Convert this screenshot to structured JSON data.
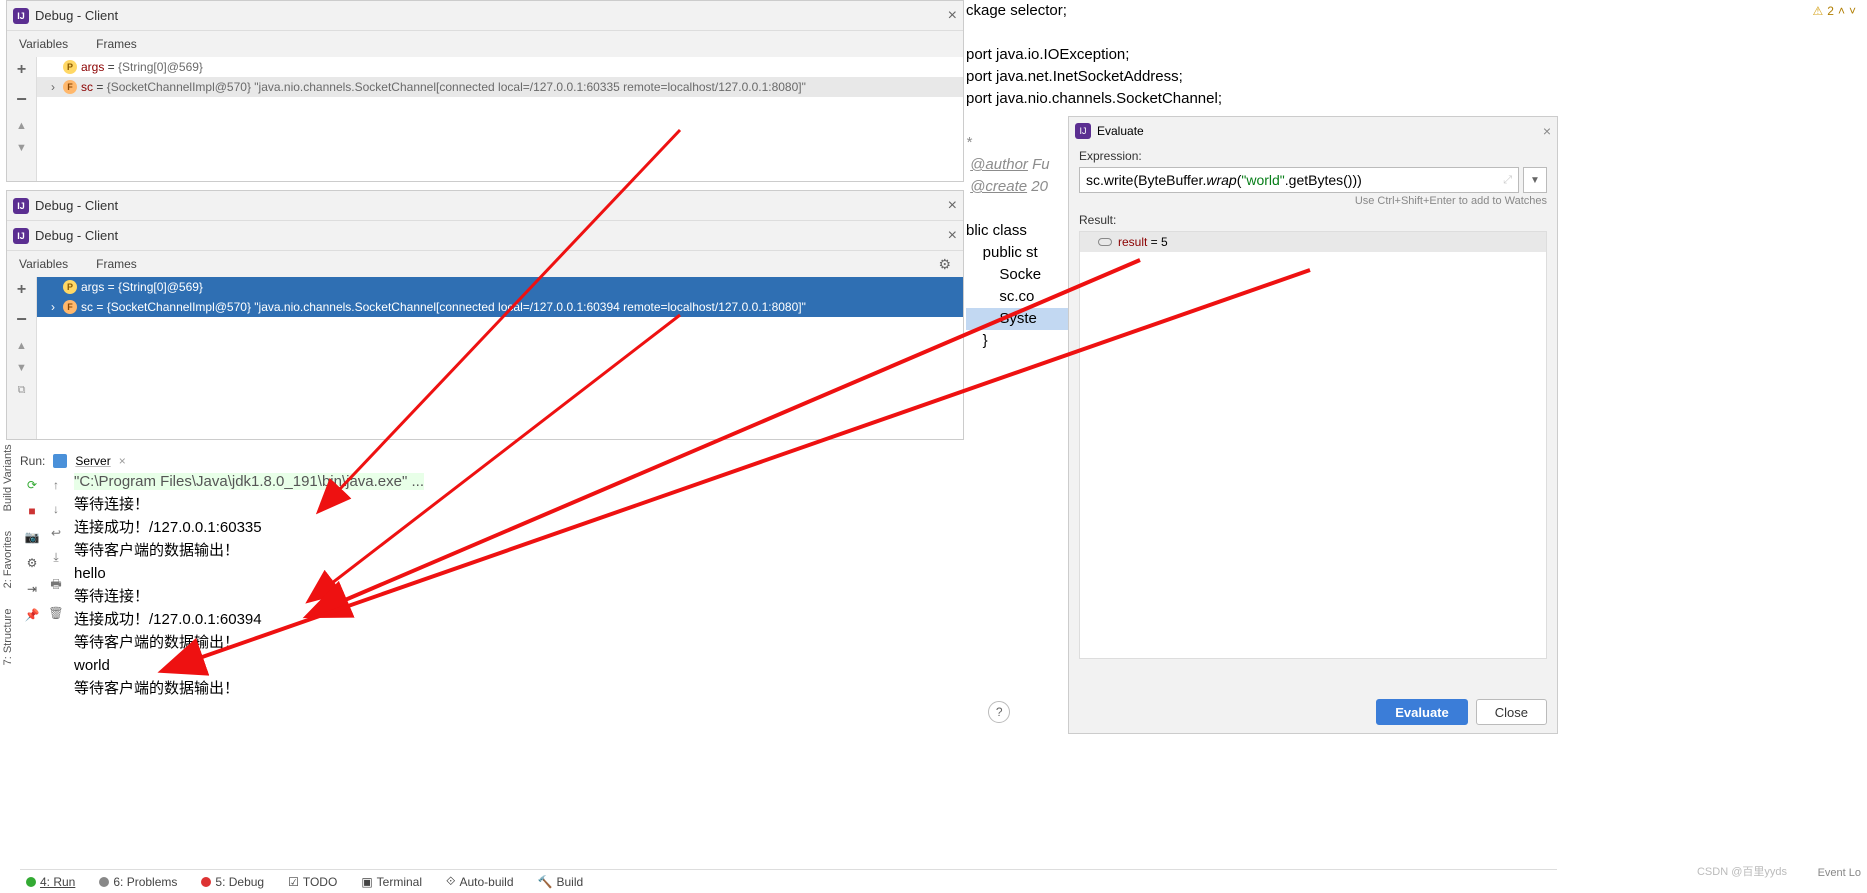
{
  "panel1": {
    "title": "Debug - Client",
    "tab_vars": "Variables",
    "tab_frames": "Frames",
    "rows": [
      {
        "icon": "p",
        "name": "args",
        "value": "{String[0]@569}"
      },
      {
        "icon": "f",
        "chev": "›",
        "name": "sc",
        "value": "{SocketChannelImpl@570} \"java.nio.channels.SocketChannel[connected local=/127.0.0.1:60335 remote=localhost/127.0.0.1:8080]\""
      }
    ]
  },
  "panel2": {
    "title": "Debug - Client",
    "tab_vars": "Variables",
    "tab_frames": "Frames",
    "rows": [
      {
        "icon": "p",
        "name": "args",
        "value": "{String[0]@569}"
      },
      {
        "icon": "f",
        "chev": "›",
        "name": "sc",
        "value": "{SocketChannelImpl@570} \"java.nio.channels.SocketChannel[connected local=/127.0.0.1:60394 remote=localhost/127.0.0.1:8080]\""
      }
    ]
  },
  "panel2b_title": "Debug - Client",
  "run": {
    "label": "Run:",
    "server": "Server",
    "lines": [
      {
        "t": "\"C:\\Program Files\\Java\\jdk1.8.0_191\\bin\\java.exe\" ...",
        "c": "cmd"
      },
      {
        "t": "等待连接！"
      },
      {
        "t": "连接成功！/127.0.0.1:60335"
      },
      {
        "t": "等待客户端的数据输出！"
      },
      {
        "t": "hello"
      },
      {
        "t": "等待连接！"
      },
      {
        "t": "连接成功！/127.0.0.1:60394"
      },
      {
        "t": "等待客户端的数据输出！"
      },
      {
        "t": "world"
      },
      {
        "t": "等待客户端的数据输出！"
      }
    ]
  },
  "leftbar": {
    "struct": "7: Structure",
    "fav": "2: Favorites",
    "bv": "Build Variants"
  },
  "bottom": {
    "run": "4: Run",
    "problems": "6: Problems",
    "debug": "5: Debug",
    "todo": "TODO",
    "terminal": "Terminal",
    "autobuild": "Auto-build",
    "build": "Build"
  },
  "code": {
    "err_count": "2",
    "l1": "ckage selector;",
    "l2": "port java.io.IOException;",
    "l3": "port java.net.InetSocketAddress;",
    "l4": "port java.nio.channels.SocketChannel;",
    "l5": "*",
    "l6a": "@author",
    "l6b": " Fu",
    "l7a": "@create",
    "l7b": " 20",
    "l8": "blic class ",
    "l9": "public st",
    "l10": "Socke",
    "l11": "sc.co",
    "l12": "Syste",
    "l13": "}"
  },
  "evaluate": {
    "title": "Evaluate",
    "expr_label": "Expression:",
    "expr_parts": {
      "a": "sc.write(ByteBuffer.",
      "b": "wrap",
      "c": "(",
      "d": "\"world\"",
      "e": ".getBytes()))"
    },
    "hint": "Use Ctrl+Shift+Enter to add to Watches",
    "result_label": "Result:",
    "result_name": "result",
    "result_value": "5",
    "btn_eval": "Evaluate",
    "btn_close": "Close"
  },
  "watermark": "CSDN @百里yyds",
  "eventlog": "Event Lo"
}
